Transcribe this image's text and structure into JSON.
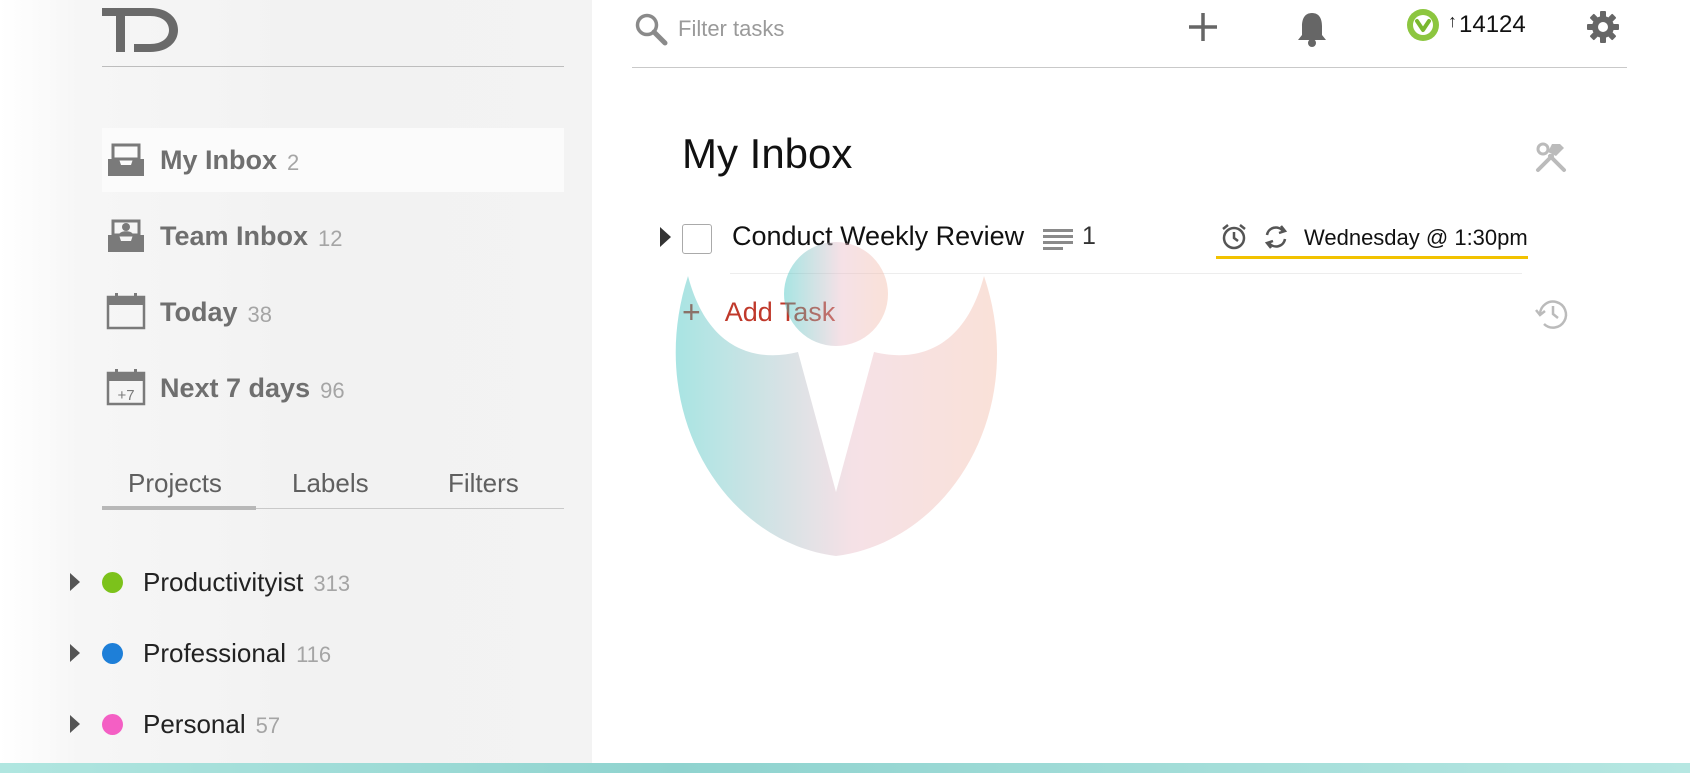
{
  "app": {
    "logo_text": "TD"
  },
  "search": {
    "placeholder": "Filter tasks"
  },
  "topbar": {
    "karma_arrow": "↑",
    "karma_value": "14124"
  },
  "sidebar": {
    "nav": [
      {
        "label": "My Inbox",
        "count": "2",
        "icon": "inbox-icon",
        "active": true
      },
      {
        "label": "Team Inbox",
        "count": "12",
        "icon": "team-inbox-icon"
      },
      {
        "label": "Today",
        "count": "38",
        "icon": "calendar-today-icon"
      },
      {
        "label": "Next 7 days",
        "count": "96",
        "icon": "calendar-next7-icon",
        "icon_text": "+7"
      }
    ],
    "tabs": [
      {
        "label": "Projects",
        "active": true
      },
      {
        "label": "Labels"
      },
      {
        "label": "Filters"
      }
    ],
    "projects": [
      {
        "label": "Productivityist",
        "count": "313",
        "color": "#7cc21b"
      },
      {
        "label": "Professional",
        "count": "116",
        "color": "#1e7fd8"
      },
      {
        "label": "Personal",
        "count": "57",
        "color": "#f45fc4"
      }
    ]
  },
  "main": {
    "title": "My Inbox",
    "tasks": [
      {
        "name": "Conduct Weekly Review",
        "notes_count": "1",
        "due": "Wednesday @ 1:30pm",
        "due_underline_color": "#f2c200"
      }
    ],
    "add_task": {
      "plus": "+",
      "label": "Add Task",
      "color": "#c0392b"
    }
  }
}
